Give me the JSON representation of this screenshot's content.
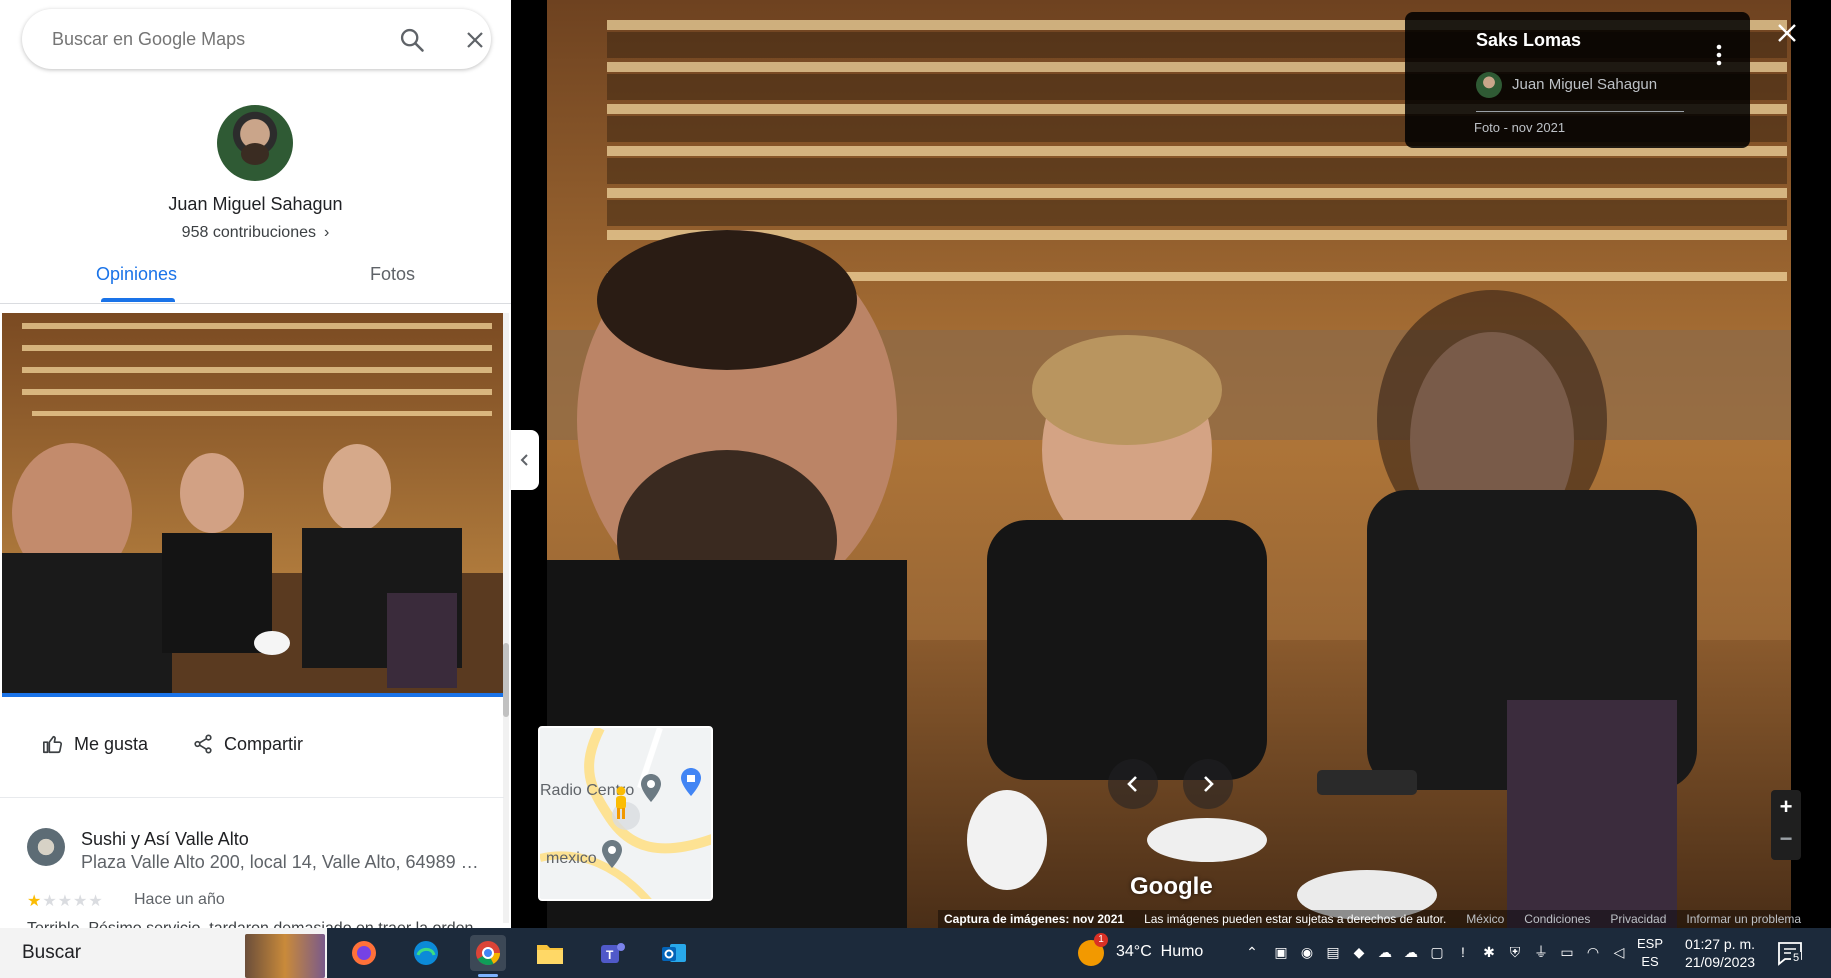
{
  "search": {
    "placeholder": "Buscar en Google Maps"
  },
  "profile": {
    "name": "Juan Miguel Sahagun",
    "contributions": "958 contribuciones",
    "tabs": [
      {
        "label": "Opiniones",
        "active": true
      },
      {
        "label": "Fotos",
        "active": false
      }
    ]
  },
  "review": {
    "actions": {
      "like_label": "Me gusta",
      "share_label": "Compartir"
    },
    "place_name": "Sushi y Así Valle Alto",
    "place_address": "Plaza Valle Alto 200, local 14, Valle Alto, 64989 M...",
    "rating": 1,
    "rating_max": 5,
    "time": "Hace un año",
    "snippet": "Terrible. Pésimo servicio, tardaron demasiado en traer la orden."
  },
  "viewer": {
    "place_title": "Saks Lomas",
    "author": "Juan Miguel Sahagun",
    "photo_date": "Foto - nov 2021",
    "logo": "Google",
    "map_labels": [
      "Radio Centro",
      "mexico"
    ],
    "attribution": {
      "capture": "Captura de imágenes: nov 2021",
      "copyright": "Las imágenes pueden estar sujetas a derechos de autor.",
      "links": [
        "México",
        "Condiciones",
        "Privacidad",
        "Informar un problema"
      ]
    },
    "zoom_in": "+",
    "zoom_out": "−"
  },
  "taskbar": {
    "search_label": "Buscar",
    "apps": [
      "firefox-icon",
      "edge-icon",
      "chrome-icon",
      "file-explorer-icon",
      "teams-icon",
      "outlook-icon"
    ],
    "weather": {
      "temp": "34°C",
      "condition": "Humo",
      "alerts": "1"
    },
    "lang_top": "ESP",
    "lang_bottom": "ES",
    "time": "01:27 p. m.",
    "date": "21/09/2023",
    "notifications": "5"
  },
  "colors": {
    "accent": "#1a73e8",
    "star": "#fbbc04",
    "taskbar": "#1c2a3b"
  }
}
